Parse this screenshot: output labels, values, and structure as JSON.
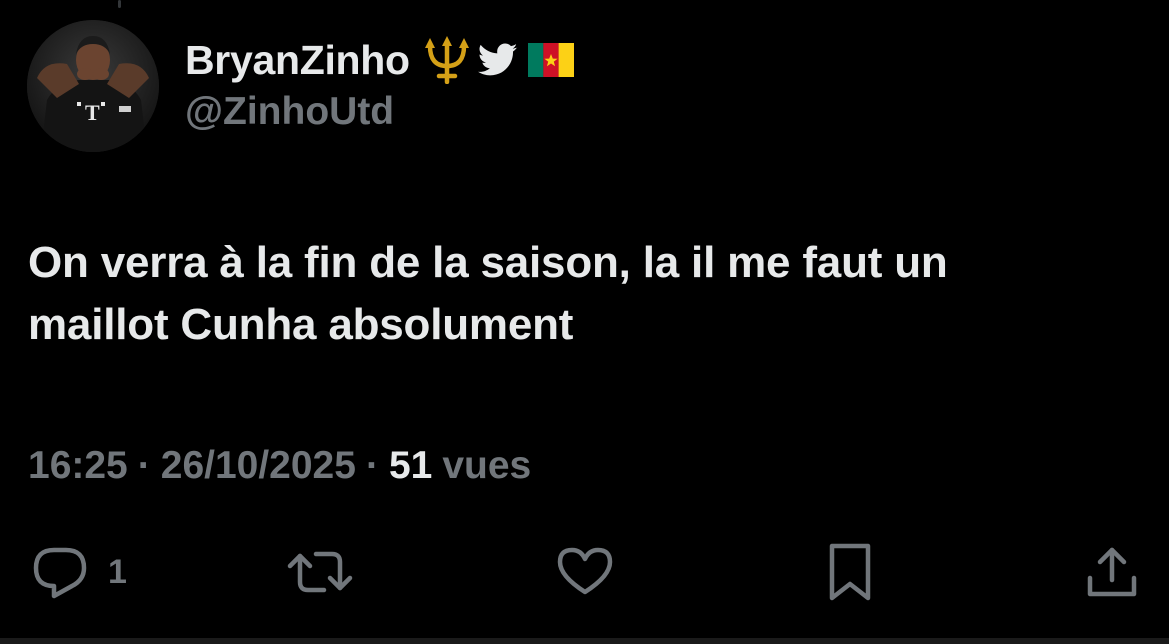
{
  "tweet": {
    "author": {
      "display_name": "BryanZinho",
      "handle": "@ZinhoUtd",
      "avatar_icon": "avatar-football-player",
      "badges": [
        "trident-emoji",
        "twitter-bird-icon",
        "cameroon-flag"
      ]
    },
    "text_line1": "On verra à la fin de la saison, la il me faut un",
    "text_line2": "maillot Cunha absolument",
    "time": "16:25",
    "separator": "·",
    "date": "26/10/2025",
    "views_count": "51",
    "views_label": "vues"
  },
  "actions": {
    "reply_count": "1",
    "icons": [
      "reply-icon",
      "retweet-icon",
      "like-icon",
      "bookmark-icon",
      "share-icon"
    ]
  },
  "colors": {
    "background": "#000000",
    "primary_text": "#e7e9ea",
    "secondary_text": "#71767b",
    "trident_gold": "#d4a017",
    "flag_green": "#007a5e",
    "flag_red": "#ce1126",
    "flag_yellow": "#fcd116"
  }
}
